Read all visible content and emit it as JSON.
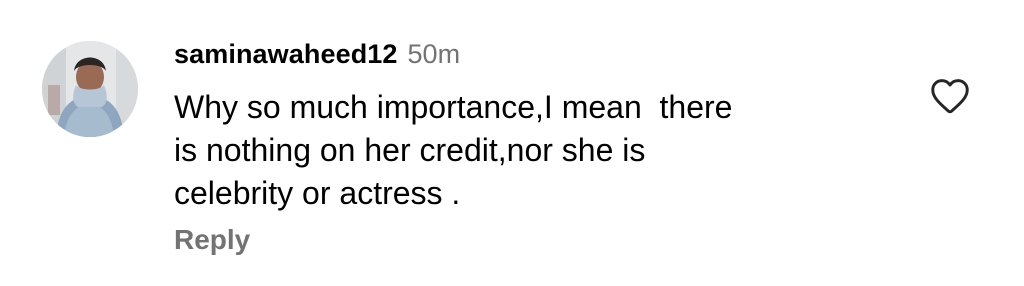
{
  "comment": {
    "username": "saminawaheed12",
    "timestamp": "50m",
    "text": "Why so much importance,I mean  there\nis nothing on her credit,nor she is\ncelebrity or actress .",
    "reply_label": "Reply",
    "like_icon": "heart-outline-icon"
  },
  "colors": {
    "primary_text": "#000000",
    "secondary_text": "#737373",
    "background": "#ffffff"
  }
}
